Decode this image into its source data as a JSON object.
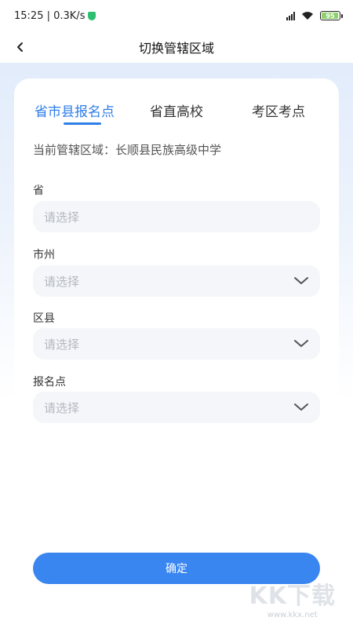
{
  "status_bar": {
    "time_speed": "15:25 | 0.3K/s",
    "battery": "95"
  },
  "header": {
    "title": "切换管辖区域"
  },
  "tabs": [
    {
      "label": "省市县报名点",
      "active": true
    },
    {
      "label": "省直高校",
      "active": false
    },
    {
      "label": "考区考点",
      "active": false
    }
  ],
  "current_area": "当前管辖区域：长顺县民族高级中学",
  "fields": [
    {
      "label": "省",
      "placeholder": "请选择"
    },
    {
      "label": "市州",
      "placeholder": "请选择"
    },
    {
      "label": "区县",
      "placeholder": "请选择"
    },
    {
      "label": "报名点",
      "placeholder": "请选择"
    }
  ],
  "confirm_label": "确定",
  "watermark": {
    "logo": "KK下载",
    "url": "www.kkx.net"
  },
  "colors": {
    "accent": "#2f7ee8",
    "button": "#3a86f0",
    "field_bg": "#f4f6f9",
    "placeholder": "#b4b8bf"
  }
}
